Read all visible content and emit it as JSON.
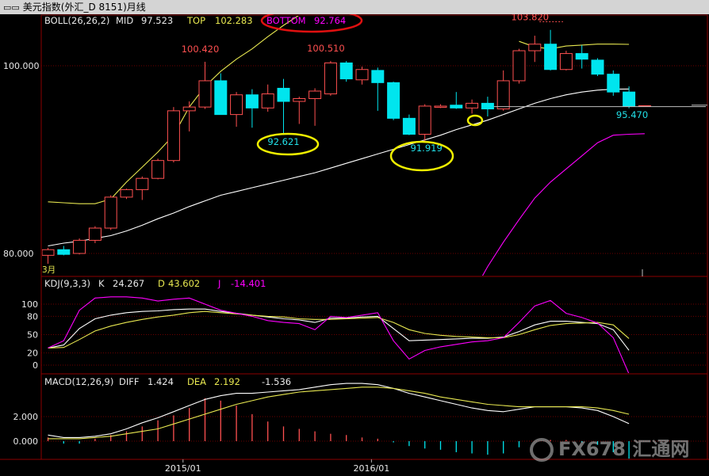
{
  "window": {
    "title": "美元指数(外汇_D 8151)月线"
  },
  "colors": {
    "background": "#000000",
    "up": "#ff5050",
    "down": "#00e5ee",
    "mid_line": "#ffffff",
    "top_line": "#e8e850",
    "bottom_line": "#ff00ff",
    "k_line": "#ffffff",
    "d_line": "#e8e850",
    "j_line": "#ff00ff",
    "panel_border": "#8b0000",
    "grid": "#6b0000"
  },
  "chart_data": [
    {
      "type": "candlestick",
      "panel": "price",
      "indicator": "BOLL(26,26,2)",
      "header": {
        "name": "BOLL(26,26,2)",
        "mid_label": "MID",
        "mid_value": "97.523",
        "top_label": "TOP",
        "top_value": "102.283",
        "bottom_label": "BOTTOM",
        "bottom_value": "92.764"
      },
      "y_ticks": [
        "100.000",
        "80.000"
      ],
      "y_tick_values": [
        100,
        80
      ],
      "ylim": [
        78.2,
        103.5
      ],
      "x_ticks": [
        "2015/01",
        "2016/01"
      ],
      "x_tick_index": [
        8.6,
        20.6
      ],
      "month_marker": "3月",
      "annotations": [
        {
          "text": "100.420",
          "bar": 10,
          "value": 100.42,
          "kind": "high"
        },
        {
          "text": "100.510",
          "bar": 18,
          "value": 100.51,
          "kind": "high"
        },
        {
          "text": "103.820",
          "bar": 31,
          "value": 103.82,
          "kind": "high"
        },
        {
          "text": "92.621",
          "bar": 15,
          "value": 92.621,
          "kind": "low"
        },
        {
          "text": "91.919",
          "bar": 24,
          "value": 91.919,
          "kind": "low"
        },
        {
          "text": "95.470",
          "bar": 37,
          "value": 95.47,
          "kind": "low"
        }
      ],
      "candles": [
        {
          "o": 79.8,
          "h": 80.6,
          "l": 78.9,
          "c": 80.4
        },
        {
          "o": 80.4,
          "h": 80.8,
          "l": 79.8,
          "c": 79.9
        },
        {
          "o": 80.0,
          "h": 81.6,
          "l": 79.9,
          "c": 81.4
        },
        {
          "o": 81.4,
          "h": 82.9,
          "l": 81.1,
          "c": 82.7
        },
        {
          "o": 82.7,
          "h": 86.2,
          "l": 82.5,
          "c": 86.0
        },
        {
          "o": 86.0,
          "h": 86.9,
          "l": 85.8,
          "c": 86.8
        },
        {
          "o": 86.8,
          "h": 88.2,
          "l": 85.7,
          "c": 88.0
        },
        {
          "o": 88.0,
          "h": 90.1,
          "l": 87.9,
          "c": 89.9
        },
        {
          "o": 89.9,
          "h": 95.6,
          "l": 89.7,
          "c": 95.2
        },
        {
          "o": 95.2,
          "h": 96.2,
          "l": 93.0,
          "c": 95.6
        },
        {
          "o": 95.6,
          "h": 100.42,
          "l": 95.4,
          "c": 98.4
        },
        {
          "o": 98.4,
          "h": 99.2,
          "l": 94.8,
          "c": 94.8
        },
        {
          "o": 94.8,
          "h": 97.2,
          "l": 93.5,
          "c": 96.9
        },
        {
          "o": 96.9,
          "h": 97.5,
          "l": 93.4,
          "c": 95.5
        },
        {
          "o": 95.5,
          "h": 98.0,
          "l": 95.1,
          "c": 97.0
        },
        {
          "o": 97.6,
          "h": 98.6,
          "l": 92.621,
          "c": 96.2
        },
        {
          "o": 96.2,
          "h": 96.7,
          "l": 93.8,
          "c": 96.5
        },
        {
          "o": 96.5,
          "h": 97.6,
          "l": 93.6,
          "c": 97.3
        },
        {
          "o": 97.0,
          "h": 100.51,
          "l": 96.8,
          "c": 100.3
        },
        {
          "o": 100.3,
          "h": 100.5,
          "l": 98.3,
          "c": 98.6
        },
        {
          "o": 98.5,
          "h": 99.9,
          "l": 98.0,
          "c": 99.6
        },
        {
          "o": 99.5,
          "h": 99.8,
          "l": 95.2,
          "c": 98.2
        },
        {
          "o": 98.2,
          "h": 98.3,
          "l": 94.2,
          "c": 94.4
        },
        {
          "o": 94.4,
          "h": 94.8,
          "l": 92.6,
          "c": 92.7
        },
        {
          "o": 92.7,
          "h": 95.9,
          "l": 91.919,
          "c": 95.7
        },
        {
          "o": 95.7,
          "h": 95.9,
          "l": 95.5,
          "c": 95.7
        },
        {
          "o": 95.8,
          "h": 97.2,
          "l": 95.4,
          "c": 95.5
        },
        {
          "o": 95.5,
          "h": 96.4,
          "l": 94.9,
          "c": 96.0
        },
        {
          "o": 96.0,
          "h": 96.7,
          "l": 94.6,
          "c": 95.4
        },
        {
          "o": 95.4,
          "h": 99.5,
          "l": 95.2,
          "c": 98.4
        },
        {
          "o": 98.4,
          "h": 101.8,
          "l": 98.1,
          "c": 101.6
        },
        {
          "o": 101.6,
          "h": 103.2,
          "l": 100.4,
          "c": 102.3
        },
        {
          "o": 102.3,
          "h": 103.82,
          "l": 99.5,
          "c": 99.6
        },
        {
          "o": 99.6,
          "h": 101.6,
          "l": 99.5,
          "c": 101.3
        },
        {
          "o": 101.3,
          "h": 102.2,
          "l": 99.7,
          "c": 100.7
        },
        {
          "o": 100.6,
          "h": 100.8,
          "l": 98.9,
          "c": 99.1
        },
        {
          "o": 99.1,
          "h": 99.5,
          "l": 96.8,
          "c": 97.2
        },
        {
          "o": 97.2,
          "h": 97.8,
          "l": 95.47,
          "c": 95.7
        }
      ],
      "partial_candle": {
        "value": 95.7
      },
      "series": [
        {
          "name": "MID",
          "values": [
            80.8,
            81.1,
            81.3,
            81.6,
            81.9,
            82.4,
            83.0,
            83.7,
            84.3,
            85.0,
            85.6,
            86.2,
            86.6,
            87.0,
            87.4,
            87.8,
            88.2,
            88.6,
            89.1,
            89.6,
            90.1,
            90.6,
            91.1,
            91.6,
            92.1,
            92.6,
            93.2,
            93.7,
            94.2,
            94.8,
            95.4,
            96.0,
            96.5,
            96.9,
            97.2,
            97.4,
            97.5,
            97.52
          ]
        },
        {
          "name": "TOP",
          "values": [
            85.5,
            85.4,
            85.3,
            85.3,
            85.8,
            87.6,
            89.2,
            90.8,
            92.6,
            95.6,
            97.8,
            99.4,
            100.7,
            101.8,
            103.1,
            104.3,
            105.4,
            106.6,
            107.9,
            109.1,
            110.3,
            111.4,
            112.5,
            113.6,
            114.6,
            null,
            null,
            null,
            null,
            null,
            102.6,
            102.0,
            101.8,
            102.1,
            102.2,
            102.3,
            102.3,
            102.28
          ]
        },
        {
          "name": "BOTTOM",
          "values": [
            null,
            null,
            null,
            null,
            null,
            null,
            null,
            null,
            null,
            null,
            null,
            null,
            null,
            null,
            null,
            null,
            null,
            null,
            null,
            null,
            null,
            null,
            null,
            null,
            null,
            null,
            null,
            75.6,
            78.6,
            81.2,
            83.6,
            85.9,
            87.6,
            89.0,
            90.4,
            91.8,
            92.6,
            92.7,
            92.76
          ]
        }
      ]
    },
    {
      "type": "line",
      "panel": "kdj",
      "indicator": "KDJ(9,3,3)",
      "header": {
        "name": "KDJ(9,3,3)",
        "k_label": "K",
        "k_value": "24.267",
        "d_label": "D",
        "d_value": "43.602",
        "j_label": "J",
        "j_value": "-14.401"
      },
      "y_ticks": [
        "100",
        "80",
        "50",
        "20",
        "0"
      ],
      "y_tick_values": [
        100,
        80,
        50,
        20,
        0
      ],
      "ylim": [
        -14.4,
        116
      ],
      "series": [
        {
          "name": "K",
          "values": [
            28,
            33,
            60,
            76,
            82,
            86,
            88,
            89,
            91,
            92,
            92,
            88,
            85,
            82,
            79,
            76,
            74,
            70,
            77,
            77,
            79,
            80,
            60,
            40,
            41,
            42,
            43,
            44,
            44,
            46,
            55,
            66,
            72,
            72,
            70,
            68,
            58,
            24.3
          ]
        },
        {
          "name": "D",
          "values": [
            28,
            29,
            42,
            56,
            64,
            70,
            75,
            79,
            82,
            86,
            88,
            86,
            84,
            82,
            80,
            79,
            76,
            75,
            75,
            76,
            77,
            78,
            70,
            58,
            52,
            49,
            47,
            46,
            45,
            45,
            50,
            58,
            65,
            68,
            69,
            70,
            66,
            43.6
          ]
        },
        {
          "name": "J",
          "values": [
            28,
            40,
            90,
            110,
            112,
            112,
            110,
            105,
            108,
            110,
            100,
            90,
            85,
            80,
            73,
            70,
            68,
            58,
            80,
            78,
            82,
            86,
            40,
            10,
            24,
            30,
            34,
            38,
            40,
            45,
            70,
            97,
            106,
            85,
            78,
            69,
            45,
            -14.4
          ]
        }
      ]
    },
    {
      "type": "bar",
      "panel": "macd",
      "indicator": "MACD(12,26,9)",
      "header": {
        "name": "MACD(12,26,9)",
        "diff_label": "DIFF",
        "diff_value": "1.424",
        "dea_label": "DEA",
        "dea_value": "2.192",
        "macd_value": "-1.536"
      },
      "y_ticks": [
        "2.000",
        "0.000"
      ],
      "y_tick_values": [
        2.0,
        0.0
      ],
      "ylim": [
        -1.7,
        5.4
      ],
      "series": [
        {
          "name": "DIFF",
          "values": [
            0.5,
            0.3,
            0.3,
            0.4,
            0.6,
            1.0,
            1.5,
            1.9,
            2.4,
            2.9,
            3.4,
            3.7,
            3.9,
            3.9,
            4.0,
            4.1,
            4.2,
            4.4,
            4.6,
            4.7,
            4.7,
            4.6,
            4.3,
            3.9,
            3.6,
            3.3,
            3.0,
            2.7,
            2.5,
            2.4,
            2.6,
            2.8,
            2.8,
            2.8,
            2.7,
            2.5,
            2.0,
            1.424
          ]
        },
        {
          "name": "DEA",
          "values": [
            0.2,
            0.2,
            0.2,
            0.3,
            0.4,
            0.6,
            0.8,
            1.0,
            1.4,
            1.8,
            2.2,
            2.6,
            3.0,
            3.3,
            3.6,
            3.8,
            4.0,
            4.1,
            4.2,
            4.3,
            4.4,
            4.4,
            4.3,
            4.1,
            3.9,
            3.6,
            3.4,
            3.2,
            3.0,
            2.9,
            2.8,
            2.8,
            2.8,
            2.8,
            2.8,
            2.7,
            2.5,
            2.192
          ]
        },
        {
          "name": "MACD",
          "values": [
            0.3,
            -0.2,
            -0.2,
            0.2,
            0.5,
            0.8,
            1.2,
            1.7,
            2.1,
            2.7,
            3.5,
            3.3,
            2.9,
            2.2,
            1.6,
            1.2,
            1.0,
            0.8,
            0.6,
            0.5,
            0.3,
            0.2,
            -0.1,
            -0.4,
            -0.6,
            -0.7,
            -0.9,
            -1.0,
            -1.1,
            -1.0,
            -0.5,
            0.0,
            0.1,
            0.1,
            -0.1,
            -0.3,
            -0.9,
            -1.536
          ]
        }
      ]
    }
  ],
  "watermark": {
    "text": "FX678 汇通网"
  }
}
